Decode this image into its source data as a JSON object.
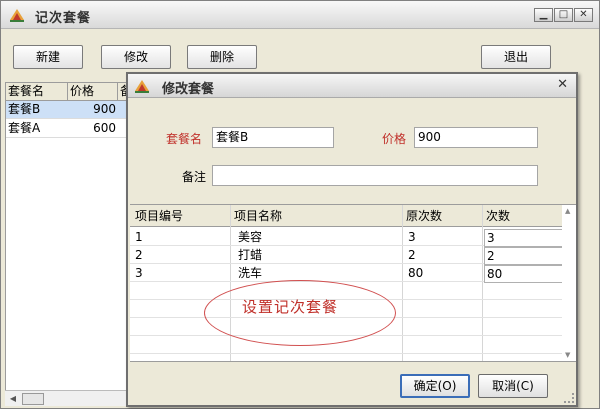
{
  "main": {
    "title": "记次套餐",
    "toolbar": {
      "new_label": "新建",
      "edit_label": "修改",
      "delete_label": "删除",
      "exit_label": "退出"
    },
    "grid": {
      "columns": [
        "套餐名",
        "价格",
        "备"
      ],
      "rows": [
        {
          "name": "套餐B",
          "price": "900",
          "selected": true
        },
        {
          "name": "套餐A",
          "price": "600",
          "selected": false
        }
      ]
    }
  },
  "dialog": {
    "title": "修改套餐",
    "name_label": "套餐名",
    "name_value": "套餐B",
    "price_label": "价格",
    "price_value": "900",
    "remark_label": "备注",
    "remark_value": "",
    "grid": {
      "columns": [
        "项目编号",
        "项目名称",
        "原次数",
        "次数"
      ],
      "rows": [
        {
          "id": "1",
          "name": "美容",
          "orig": "3",
          "count": "3"
        },
        {
          "id": "2",
          "name": "打蜡",
          "orig": "2",
          "count": "2"
        },
        {
          "id": "3",
          "name": "洗车",
          "orig": "80",
          "count": "80"
        }
      ]
    },
    "annotation": "设置记次套餐",
    "ok_label": "确定(O)",
    "cancel_label": "取消(C)"
  },
  "colors": {
    "label_red": "#c0302a",
    "selection": "#cde0f7",
    "window_bg": "#ece9d8"
  }
}
